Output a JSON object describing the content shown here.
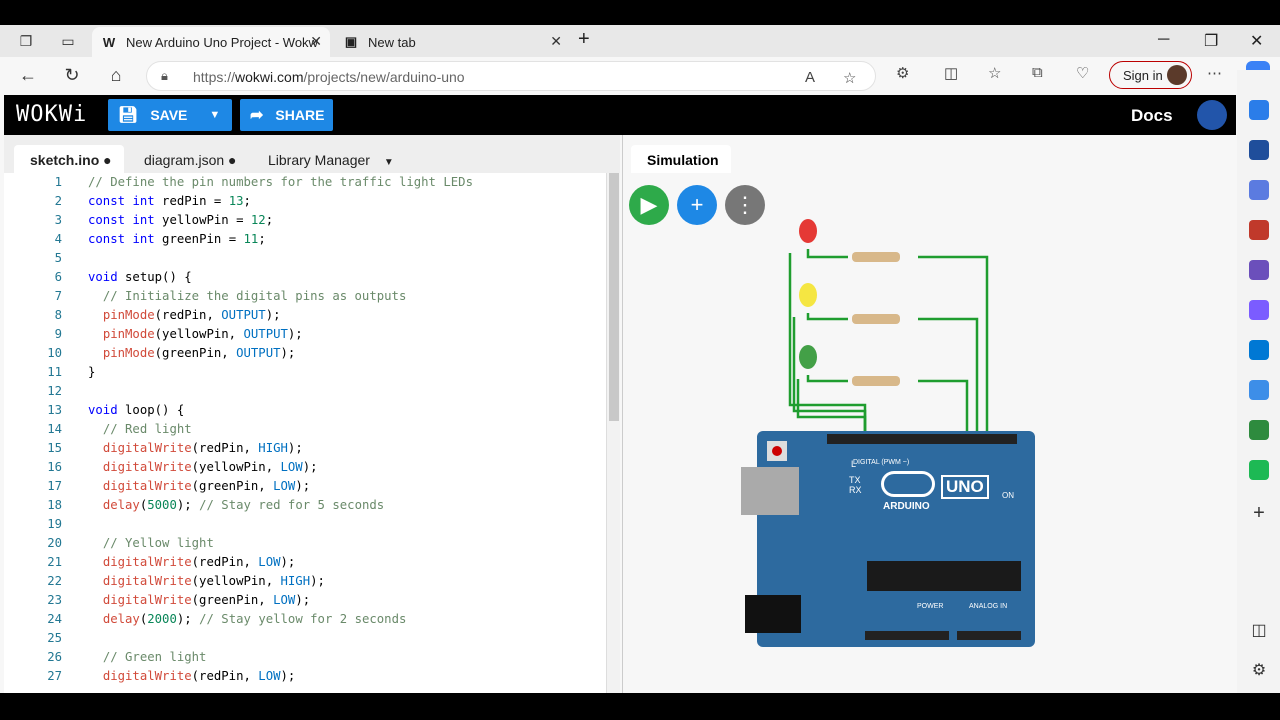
{
  "browser": {
    "tabs": [
      {
        "label": "New Arduino Uno Project - Wokw",
        "icon": "wokwi-w-icon"
      },
      {
        "label": "New tab",
        "icon": "newtab-icon"
      }
    ],
    "url_prefix": "https://",
    "url_domain": "wokwi.com",
    "url_path": "/projects/new/arduino-uno",
    "sign_in": "Sign in"
  },
  "wokwi": {
    "logo": "WOKWi",
    "save": "SAVE",
    "share": "SHARE",
    "docs": "Docs"
  },
  "editor": {
    "tabs": [
      "sketch.ino",
      "diagram.json",
      "Library Manager"
    ],
    "lines": [
      {
        "n": "1",
        "t": "// Define the pin numbers for the traffic light LEDs"
      },
      {
        "n": "2",
        "t": "const int redPin = 13;"
      },
      {
        "n": "3",
        "t": "const int yellowPin = 12;"
      },
      {
        "n": "4",
        "t": "const int greenPin = 11;"
      },
      {
        "n": "5",
        "t": ""
      },
      {
        "n": "6",
        "t": "void setup() {"
      },
      {
        "n": "7",
        "t": "  // Initialize the digital pins as outputs"
      },
      {
        "n": "8",
        "t": "  pinMode(redPin, OUTPUT);"
      },
      {
        "n": "9",
        "t": "  pinMode(yellowPin, OUTPUT);"
      },
      {
        "n": "10",
        "t": "  pinMode(greenPin, OUTPUT);"
      },
      {
        "n": "11",
        "t": "}"
      },
      {
        "n": "12",
        "t": ""
      },
      {
        "n": "13",
        "t": "void loop() {"
      },
      {
        "n": "14",
        "t": "  // Red light"
      },
      {
        "n": "15",
        "t": "  digitalWrite(redPin, HIGH);"
      },
      {
        "n": "16",
        "t": "  digitalWrite(yellowPin, LOW);"
      },
      {
        "n": "17",
        "t": "  digitalWrite(greenPin, LOW);"
      },
      {
        "n": "18",
        "t": "  delay(5000); // Stay red for 5 seconds"
      },
      {
        "n": "19",
        "t": ""
      },
      {
        "n": "20",
        "t": "  // Yellow light"
      },
      {
        "n": "21",
        "t": "  digitalWrite(redPin, LOW);"
      },
      {
        "n": "22",
        "t": "  digitalWrite(yellowPin, HIGH);"
      },
      {
        "n": "23",
        "t": "  digitalWrite(greenPin, LOW);"
      },
      {
        "n": "24",
        "t": "  delay(2000); // Stay yellow for 2 seconds"
      },
      {
        "n": "25",
        "t": ""
      },
      {
        "n": "26",
        "t": "  // Green light"
      },
      {
        "n": "27",
        "t": "  digitalWrite(redPin, LOW);"
      }
    ]
  },
  "simulation": {
    "tab": "Simulation",
    "board_brand": "ARDUINO",
    "board_model": "UNO",
    "digital_label": "DIGITAL (PWM ~)",
    "analog_label": "ANALOG IN",
    "power_label": "POWER",
    "on_label": "ON",
    "tx_label": "TX",
    "rx_label": "RX",
    "l_label": "L",
    "led_colors": [
      "#e53935",
      "#f5e642",
      "#43a047"
    ],
    "wire_color": "#1f9d2f"
  }
}
